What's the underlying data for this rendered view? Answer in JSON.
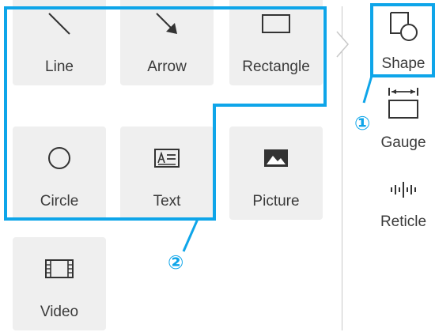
{
  "palette": {
    "tiles": [
      {
        "label": "Line",
        "icon": "line-icon"
      },
      {
        "label": "Arrow",
        "icon": "arrow-icon"
      },
      {
        "label": "Rectangle",
        "icon": "rectangle-icon"
      },
      {
        "label": "Circle",
        "icon": "circle-icon"
      },
      {
        "label": "Text",
        "icon": "text-box-icon"
      },
      {
        "label": "Picture",
        "icon": "picture-icon"
      },
      {
        "label": "Video",
        "icon": "video-icon"
      }
    ]
  },
  "toolbar": {
    "items": [
      {
        "label": "Shape",
        "icon": "shape-icon"
      },
      {
        "label": "Gauge",
        "icon": "gauge-icon"
      },
      {
        "label": "Reticle",
        "icon": "reticle-icon"
      }
    ]
  },
  "callouts": {
    "one": "①",
    "two": "②"
  },
  "colors": {
    "highlight": "#0ea5e9",
    "tile_bg": "#efefef",
    "label_text": "#3a3a3a"
  }
}
